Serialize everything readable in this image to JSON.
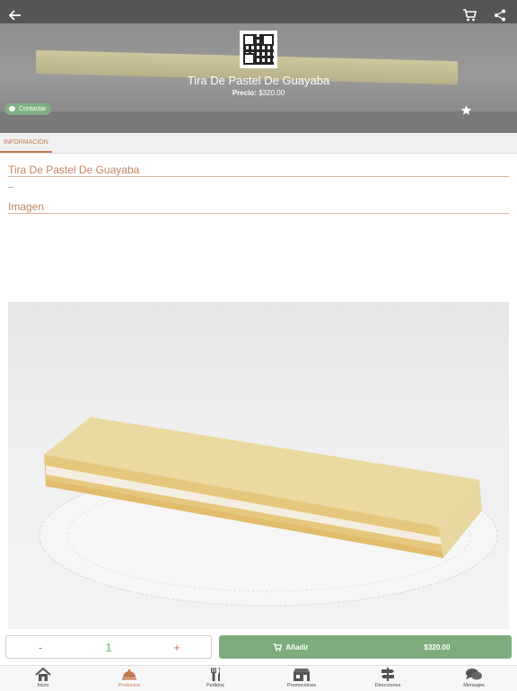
{
  "header": {
    "back_icon": "arrow-left-icon",
    "cart_icon": "cart-icon",
    "share_icon": "share-icon"
  },
  "product": {
    "title": "Tira De Pastel De Guayaba",
    "price_label": "Precio:",
    "price_value": "$320.00",
    "contact_label": "Contactar",
    "favorite_icon": "star-icon"
  },
  "tabs": [
    {
      "label": "INFORMACIÓN",
      "active": true
    }
  ],
  "info": {
    "title": "Tira De Pastel De Guayaba",
    "description": "--",
    "image_section_title": "Imagen"
  },
  "actions": {
    "minus": "-",
    "quantity": "1",
    "plus": "+",
    "add_label": "Añadir",
    "add_price": "$320.00"
  },
  "nav": [
    {
      "label": "Inicio",
      "icon": "home-icon",
      "active": false
    },
    {
      "label": "Productos",
      "icon": "cloche-icon",
      "active": true
    },
    {
      "label": "Pedidos",
      "icon": "utensils-icon",
      "active": false
    },
    {
      "label": "Promociones",
      "icon": "store-icon",
      "active": false
    },
    {
      "label": "Direcciones",
      "icon": "signpost-icon",
      "active": false
    },
    {
      "label": "Mensajes",
      "icon": "chat-bubbles-icon",
      "active": false
    }
  ],
  "colors": {
    "accent": "#c47a54",
    "green": "#7fac7f"
  }
}
